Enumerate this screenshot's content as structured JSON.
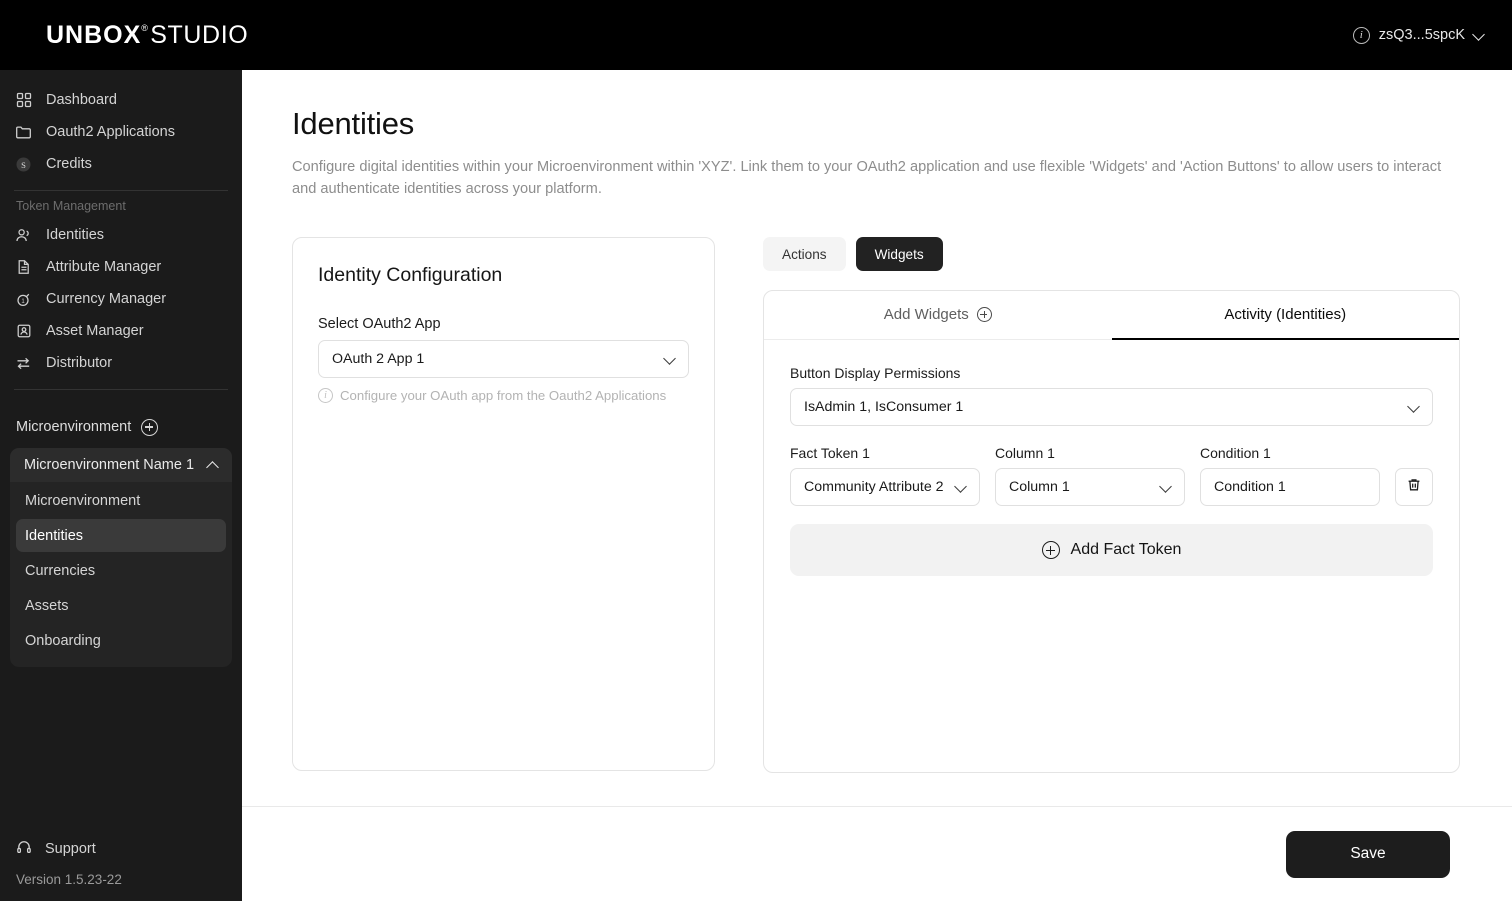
{
  "topbar": {
    "logo_main": "UNBOX",
    "logo_reg": "®",
    "logo_sub": "STUDIO",
    "user_label": "zsQ3...5spcK",
    "info_glyph": "i"
  },
  "sidebar": {
    "primary": [
      {
        "label": "Dashboard",
        "icon": "grid-icon"
      },
      {
        "label": "Oauth2 Applications",
        "icon": "folder-icon"
      },
      {
        "label": "Credits",
        "icon": "coin-icon"
      }
    ],
    "section_label": "Token Management",
    "token_items": [
      {
        "label": "Identities",
        "icon": "users-icon"
      },
      {
        "label": "Attribute Manager",
        "icon": "document-icon"
      },
      {
        "label": "Currency Manager",
        "icon": "currency-icon"
      },
      {
        "label": "Asset Manager",
        "icon": "asset-icon"
      },
      {
        "label": "Distributor",
        "icon": "transfer-icon"
      }
    ],
    "microenvironment_label": "Microenvironment",
    "group_name": "Microenvironment Name 1",
    "group_items": [
      {
        "label": "Microenvironment",
        "active": false
      },
      {
        "label": "Identities",
        "active": true
      },
      {
        "label": "Currencies",
        "active": false
      },
      {
        "label": "Assets",
        "active": false
      },
      {
        "label": "Onboarding",
        "active": false
      }
    ],
    "support_label": "Support",
    "version": "Version 1.5.23-22"
  },
  "page": {
    "title": "Identities",
    "subtitle": "Configure digital identities within your Microenvironment within 'XYZ'. Link them to your OAuth2 application and use flexible 'Widgets' and 'Action Buttons' to allow users to interact and authenticate identities across your platform."
  },
  "identity_config": {
    "card_title": "Identity Configuration",
    "select_label": "Select OAuth2 App",
    "select_value": "OAuth 2 App 1",
    "hint": "Configure your OAuth app from the Oauth2 Applications"
  },
  "mode_toggle": {
    "actions_label": "Actions",
    "widgets_label": "Widgets",
    "selected": "Widgets"
  },
  "tabs": [
    {
      "label": "Add Widgets",
      "icon": "plus-circle-icon",
      "active": false
    },
    {
      "label": "Activity (Identities)",
      "icon": "",
      "active": true
    }
  ],
  "widget_form": {
    "permissions_label": "Button Display Permissions",
    "permissions_value": "IsAdmin 1, IsConsumer 1",
    "fact_token_label": "Fact Token 1",
    "fact_token_value": "Community Attribute 2",
    "column_label": "Column 1",
    "column_value": "Column 1",
    "condition_label": "Condition 1",
    "condition_value": "Condition 1",
    "add_fact_token_label": "Add Fact Token"
  },
  "footer": {
    "save_label": "Save"
  },
  "colors": {
    "accent_dark": "#1d1d1d",
    "sidebar_bg": "#1b1b1b",
    "active_sidebar": "#3a3a3a"
  }
}
